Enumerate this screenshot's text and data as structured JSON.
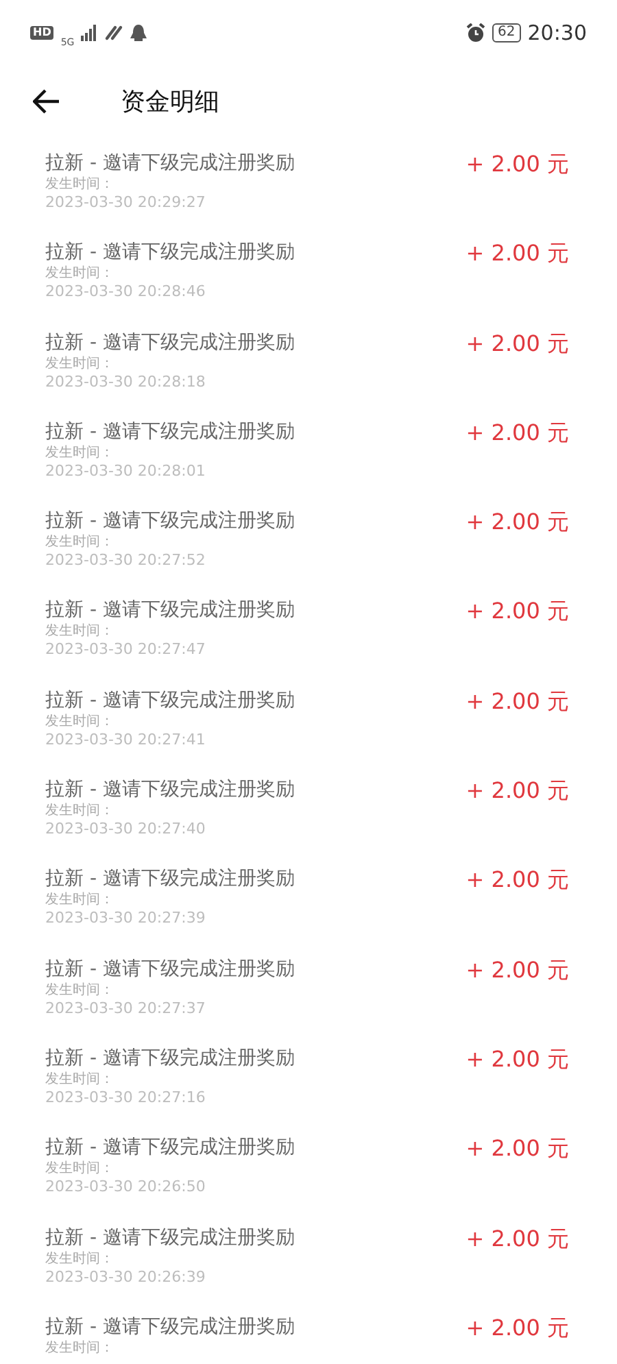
{
  "status_bar": {
    "hd": "HD",
    "network": "5G",
    "battery": "62",
    "time": "20:30"
  },
  "header": {
    "title": "资金明细"
  },
  "records": [
    {
      "title": "拉新 - 邀请下级完成注册奖励",
      "time_label": "发生时间：",
      "time": "2023-03-30 20:29:27",
      "amount": "+ 2.00 元"
    },
    {
      "title": "拉新 - 邀请下级完成注册奖励",
      "time_label": "发生时间：",
      "time": "2023-03-30 20:28:46",
      "amount": "+ 2.00 元"
    },
    {
      "title": "拉新 - 邀请下级完成注册奖励",
      "time_label": "发生时间：",
      "time": "2023-03-30 20:28:18",
      "amount": "+ 2.00 元"
    },
    {
      "title": "拉新 - 邀请下级完成注册奖励",
      "time_label": "发生时间：",
      "time": "2023-03-30 20:28:01",
      "amount": "+ 2.00 元"
    },
    {
      "title": "拉新 - 邀请下级完成注册奖励",
      "time_label": "发生时间：",
      "time": "2023-03-30 20:27:52",
      "amount": "+ 2.00 元"
    },
    {
      "title": "拉新 - 邀请下级完成注册奖励",
      "time_label": "发生时间：",
      "time": "2023-03-30 20:27:47",
      "amount": "+ 2.00 元"
    },
    {
      "title": "拉新 - 邀请下级完成注册奖励",
      "time_label": "发生时间：",
      "time": "2023-03-30 20:27:41",
      "amount": "+ 2.00 元"
    },
    {
      "title": "拉新 - 邀请下级完成注册奖励",
      "time_label": "发生时间：",
      "time": "2023-03-30 20:27:40",
      "amount": "+ 2.00 元"
    },
    {
      "title": "拉新 - 邀请下级完成注册奖励",
      "time_label": "发生时间：",
      "time": "2023-03-30 20:27:39",
      "amount": "+ 2.00 元"
    },
    {
      "title": "拉新 - 邀请下级完成注册奖励",
      "time_label": "发生时间：",
      "time": "2023-03-30 20:27:37",
      "amount": "+ 2.00 元"
    },
    {
      "title": "拉新 - 邀请下级完成注册奖励",
      "time_label": "发生时间：",
      "time": "2023-03-30 20:27:16",
      "amount": "+ 2.00 元"
    },
    {
      "title": "拉新 - 邀请下级完成注册奖励",
      "time_label": "发生时间：",
      "time": "2023-03-30 20:26:50",
      "amount": "+ 2.00 元"
    },
    {
      "title": "拉新 - 邀请下级完成注册奖励",
      "time_label": "发生时间：",
      "time": "2023-03-30 20:26:39",
      "amount": "+ 2.00 元"
    },
    {
      "title": "拉新 - 邀请下级完成注册奖励",
      "time_label": "发生时间：",
      "amount": "+ 2.00 元"
    }
  ]
}
